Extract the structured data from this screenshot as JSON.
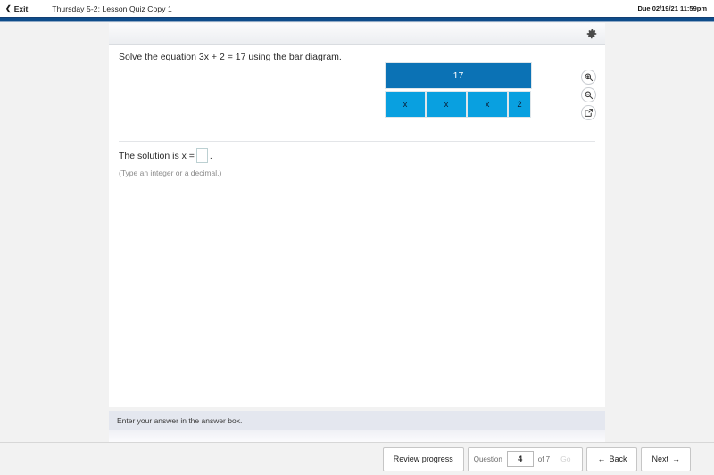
{
  "header": {
    "exit_label": "Exit",
    "exit_icon": "chevron-left-icon",
    "quiz_title": "Thursday 5-2: Lesson Quiz Copy 1",
    "due_text": "Due 02/19/21 11:59pm",
    "accent_color": "#0e4c8a"
  },
  "toolbar": {
    "settings_icon": "gear-icon"
  },
  "question": {
    "prompt": "Solve the equation 3x + 2 = 17 using the bar diagram.",
    "diagram": {
      "total_label": "17",
      "parts": [
        {
          "label": "x",
          "width": "wide"
        },
        {
          "label": "x",
          "width": "wide"
        },
        {
          "label": "x",
          "width": "wide"
        },
        {
          "label": "2",
          "width": "narrow"
        }
      ],
      "total_color": "#0b72b5",
      "part_color": "#09a0e0"
    },
    "tools": [
      {
        "name": "zoom-in-icon",
        "title": "Zoom in"
      },
      {
        "name": "zoom-out-icon",
        "title": "Zoom out"
      },
      {
        "name": "pop-out-icon",
        "title": "Open in new window"
      }
    ]
  },
  "answer": {
    "prefix": "The solution is x =",
    "suffix": ".",
    "value": "",
    "placeholder": "",
    "hint": "(Type an integer or a decimal.)"
  },
  "status": {
    "message": "Enter your answer in the answer box."
  },
  "nav": {
    "review_label": "Review progress",
    "question_label": "Question",
    "question_number": "4",
    "of_label": "of 7",
    "go_label": "Go",
    "back_label": "Back",
    "back_icon": "arrow-left-icon",
    "next_label": "Next",
    "next_icon": "arrow-right-icon"
  }
}
